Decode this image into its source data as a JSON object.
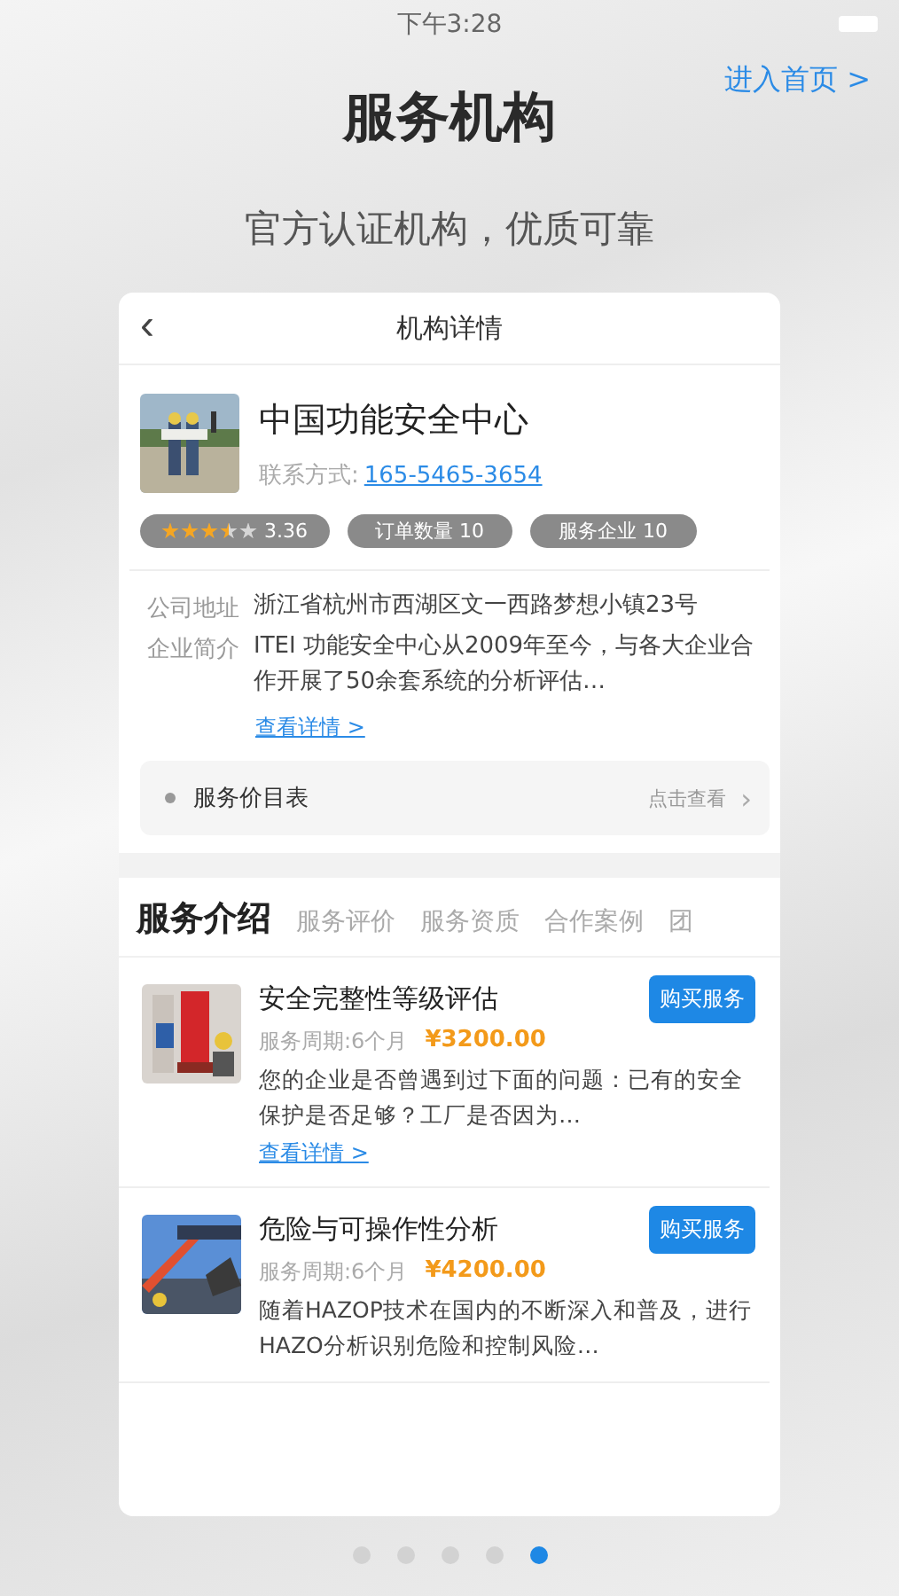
{
  "status_bar": {
    "time": "下午3:28"
  },
  "header": {
    "title": "服务机构",
    "subtitle": "官方认证机构，优质可靠",
    "home_link": "进入首页 >"
  },
  "card": {
    "nav_title": "机构详情",
    "back": "‹",
    "org": {
      "name": "中国功能安全中心",
      "contact_label": "联系方式:",
      "phone": "165-5465-3654",
      "stars": 3.5,
      "rating": "3.36",
      "badges": [
        "订单数量 10",
        "服务企业 10"
      ]
    },
    "details": [
      {
        "label": "公司地址",
        "value": "浙江省杭州市西湖区文一西路梦想小镇23号"
      },
      {
        "label": "企业简介",
        "value": "ITEI 功能安全中心从2009年至今，与各大企业合作开展了50余套系统的分析评估…"
      }
    ],
    "details_link": "查看详情 >",
    "price_list": {
      "title": "服务价目表",
      "action": "点击查看",
      "chevron": "›"
    },
    "tabs": [
      {
        "label": "服务介绍",
        "selected": true
      },
      {
        "label": "服务评价",
        "selected": false
      },
      {
        "label": "服务资质",
        "selected": false
      },
      {
        "label": "合作案例",
        "selected": false
      },
      {
        "label": "团",
        "selected": false
      }
    ],
    "services": [
      {
        "title": "安全完整性等级评估",
        "period": "服务周期:6个月",
        "price": "¥3200.00",
        "description": "您的企业是否曾遇到过下面的问题：已有的安全保护是否足够？工厂是否因为…",
        "link": "查看详情 >",
        "button": "购买服务"
      },
      {
        "title": "危险与可操作性分析",
        "period": "服务周期:6个月",
        "price": "¥4200.00",
        "description": "随着HAZOP技术在国内的不断深入和普及，进行HAZO分析识别危险和控制风险…",
        "button": "购买服务"
      }
    ]
  },
  "pager": [
    {
      "selected": false
    },
    {
      "selected": false
    },
    {
      "selected": false
    },
    {
      "selected": false
    },
    {
      "selected": true
    }
  ]
}
